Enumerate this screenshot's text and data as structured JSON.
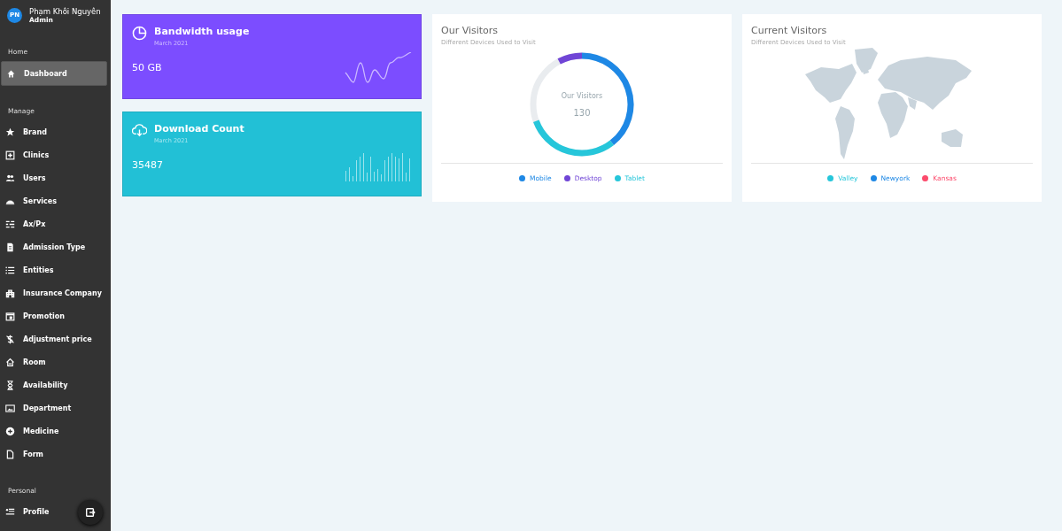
{
  "user": {
    "initials": "PN",
    "name": "Phạm Khôi Nguyên",
    "role": "Admin"
  },
  "sidebar": {
    "sections": [
      {
        "title": "Home",
        "items": [
          {
            "label": "Dashboard",
            "selected": true
          }
        ]
      },
      {
        "title": "Manage",
        "items": [
          {
            "label": "Brand",
            "selected": false
          },
          {
            "label": "Clinics",
            "selected": false
          },
          {
            "label": "Users",
            "selected": false
          },
          {
            "label": "Services",
            "selected": false
          },
          {
            "label": "Ax/Px",
            "selected": false
          },
          {
            "label": "Admission Type",
            "selected": false
          },
          {
            "label": "Entities",
            "selected": false
          },
          {
            "label": "Insurance Company",
            "selected": false
          },
          {
            "label": "Promotion",
            "selected": false
          },
          {
            "label": "Adjustment price",
            "selected": false
          },
          {
            "label": "Room",
            "selected": false
          },
          {
            "label": "Availability",
            "selected": false
          },
          {
            "label": "Department",
            "selected": false
          },
          {
            "label": "Medicine",
            "selected": false
          },
          {
            "label": "Form",
            "selected": false
          }
        ]
      },
      {
        "title": "Personal",
        "items": [
          {
            "label": "Profile",
            "selected": false
          }
        ]
      }
    ]
  },
  "stat_cards": [
    {
      "kind": "wave",
      "title": "Bandwidth usage",
      "subtitle": "March 2021",
      "value": "50 GB",
      "color": "#7c4dff"
    },
    {
      "kind": "bars",
      "title": "Download Count",
      "subtitle": "March 2021",
      "value": "35487",
      "color": "#22c0d6"
    }
  ],
  "visitors": {
    "title": "Our Visitors",
    "subtitle": "Different Devices Used to Visit",
    "center_label": "Our Visitors",
    "center_value": "130",
    "legend": [
      {
        "label": "Mobile",
        "color": "#1e88e5"
      },
      {
        "label": "Desktop",
        "color": "#7045d6"
      },
      {
        "label": "Tablet",
        "color": "#26c6da"
      }
    ]
  },
  "current_visitors": {
    "title": "Current Visitors",
    "subtitle": "Different Devices Used to Visit",
    "legend": [
      {
        "label": "Valley",
        "color": "#26c6da"
      },
      {
        "label": "Newyork",
        "color": "#1e88e5"
      },
      {
        "label": "Kansas",
        "color": "#fc4b6c"
      }
    ]
  }
}
